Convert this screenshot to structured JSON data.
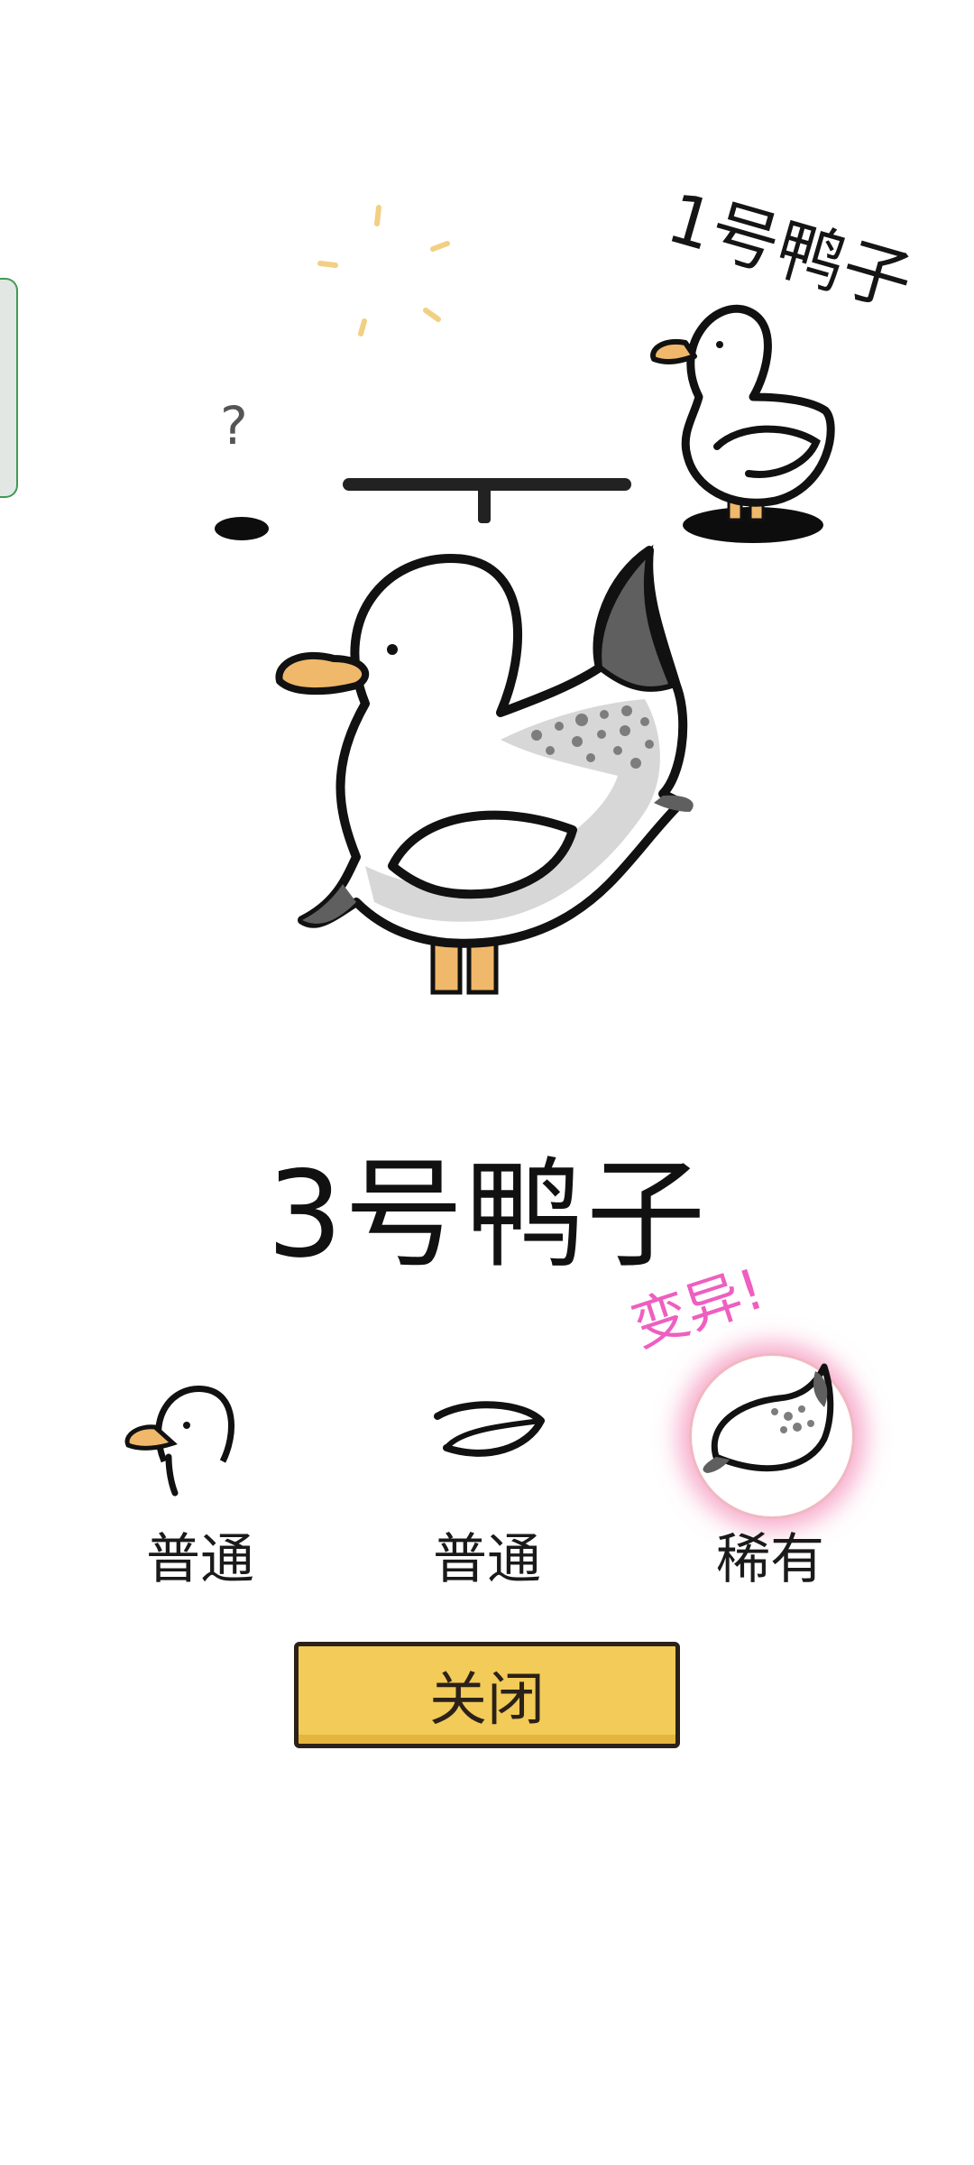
{
  "scene": {
    "question_mark": "?",
    "duck1_label": "1号鸭子"
  },
  "result": {
    "duck_name": "3号鸭子",
    "mutation_tag": "变异!",
    "parts": [
      {
        "label": "普通",
        "icon": "duck-head-icon"
      },
      {
        "label": "普通",
        "icon": "duck-wing-icon"
      },
      {
        "label": "稀有",
        "icon": "spotted-tail-icon"
      }
    ]
  },
  "actions": {
    "close_label": "关闭"
  },
  "colors": {
    "button_yellow": "#f2cb58",
    "mutation_pink": "#ee5fc0",
    "beak_orange": "#f0b86a",
    "side_tab_green": "#3f9a52"
  }
}
